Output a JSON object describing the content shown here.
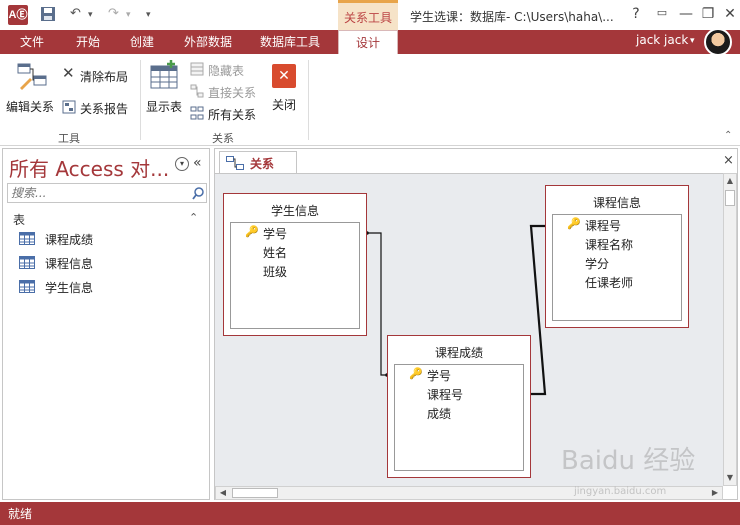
{
  "titlebar": {
    "app_badge": "AⒺ",
    "context_tab": "关系工具",
    "window_title": "学生选课：数据库- C:\\Users\\haha\\...",
    "help": "?",
    "minimize": "—",
    "restore": "❐",
    "close": "✕",
    "undo": "↶",
    "redo": "↷",
    "customize": "▾"
  },
  "tabs": [
    {
      "label": "文件"
    },
    {
      "label": "开始"
    },
    {
      "label": "创建"
    },
    {
      "label": "外部数据"
    },
    {
      "label": "数据库工具"
    },
    {
      "label": "设计"
    }
  ],
  "user": {
    "name": "jack jack",
    "dropdown": "▾"
  },
  "ribbon": {
    "tools_group": {
      "label": "工具",
      "edit_relationships": "编辑关系",
      "clear_layout": "清除布局",
      "relationship_report": "关系报告"
    },
    "relationships_group": {
      "label": "关系",
      "show_table": "显示表",
      "hide_table": "隐藏表",
      "direct_relationships": "直接关系",
      "all_relationships": "所有关系",
      "close": "关闭"
    }
  },
  "nav": {
    "title": "所有 Access 对...",
    "search_placeholder": "搜索...",
    "section": "表",
    "collapse_glyph": "⌃",
    "shutter_glyph": "«",
    "items": [
      {
        "label": "课程成绩"
      },
      {
        "label": "课程信息"
      },
      {
        "label": "学生信息"
      }
    ]
  },
  "document": {
    "tab_label": "关系",
    "close": "×",
    "tables": [
      {
        "title": "学生信息",
        "fields": [
          "学号",
          "姓名",
          "班级"
        ],
        "key_index": 0
      },
      {
        "title": "课程成绩",
        "fields": [
          "学号",
          "课程号",
          "成绩"
        ],
        "key_index": 0
      },
      {
        "title": "课程信息",
        "fields": [
          "课程号",
          "课程名称",
          "学分",
          "任课老师"
        ],
        "key_index": 0
      }
    ]
  },
  "status": {
    "text": "就绪"
  },
  "watermark": {
    "text": "Baidu 经验",
    "url": "jingyan.baidu.com"
  },
  "colors": {
    "accent": "#a4373a",
    "context_tab_bg": "#f6e3c8",
    "canvas_bg": "#e9ebee"
  }
}
